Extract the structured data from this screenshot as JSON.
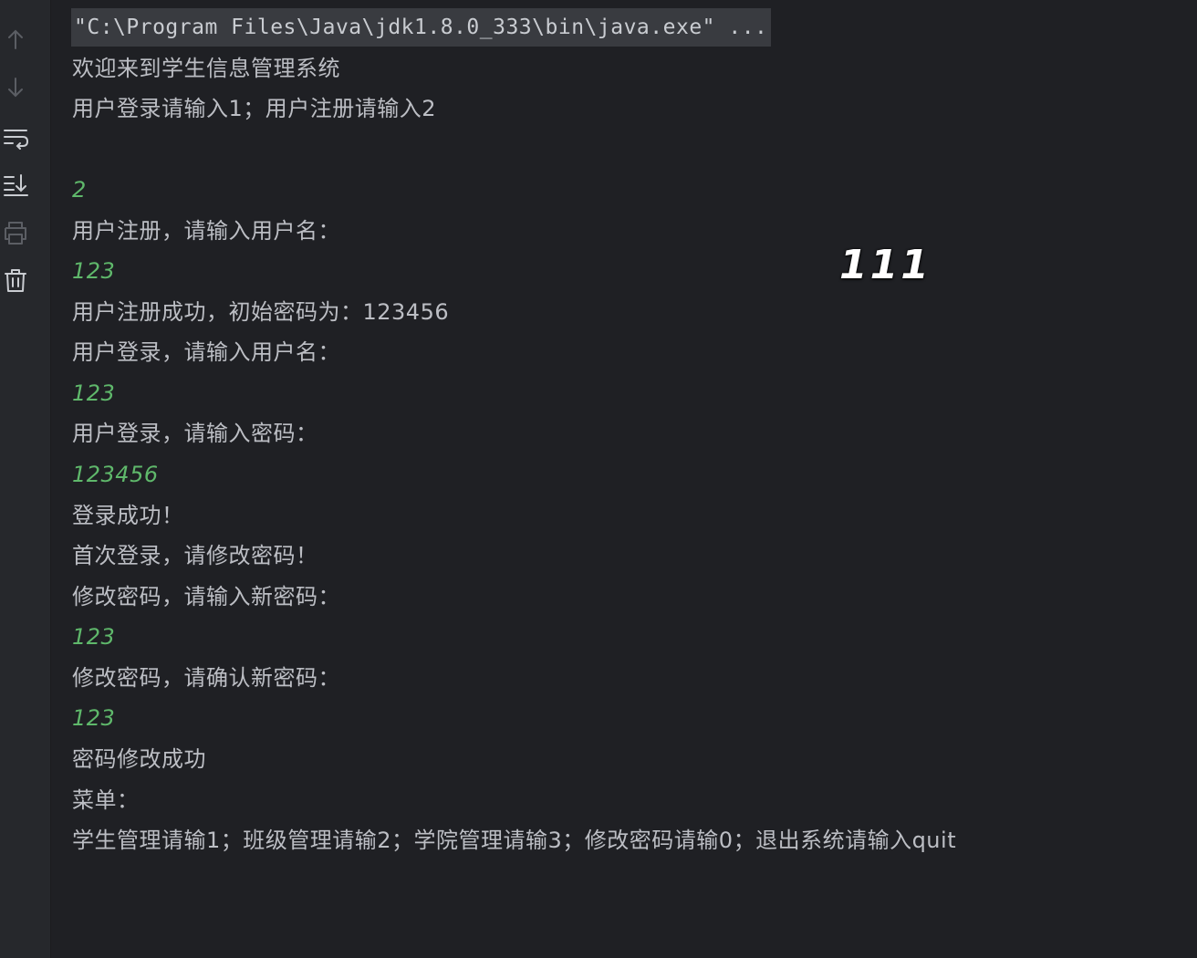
{
  "toolbar": {
    "icons": [
      "arrow-up-icon",
      "arrow-down-icon",
      "soft-wrap-icon",
      "scroll-to-end-icon",
      "print-icon",
      "trash-icon"
    ]
  },
  "console": {
    "command": "\"C:\\Program Files\\Java\\jdk1.8.0_333\\bin\\java.exe\" ...",
    "lines": [
      {
        "type": "output",
        "text": "欢迎来到学生信息管理系统"
      },
      {
        "type": "output",
        "text": "用户登录请输入1；用户注册请输入2"
      },
      {
        "type": "blank",
        "text": ""
      },
      {
        "type": "input",
        "text": "2"
      },
      {
        "type": "output",
        "text": "用户注册，请输入用户名："
      },
      {
        "type": "input",
        "text": "123"
      },
      {
        "type": "output",
        "text": "用户注册成功，初始密码为：123456"
      },
      {
        "type": "output",
        "text": "用户登录，请输入用户名："
      },
      {
        "type": "input",
        "text": "123"
      },
      {
        "type": "output",
        "text": "用户登录，请输入密码："
      },
      {
        "type": "input",
        "text": "123456"
      },
      {
        "type": "output",
        "text": "登录成功！"
      },
      {
        "type": "output",
        "text": "首次登录，请修改密码！"
      },
      {
        "type": "output",
        "text": "修改密码，请输入新密码："
      },
      {
        "type": "input",
        "text": "123"
      },
      {
        "type": "output",
        "text": "修改密码，请确认新密码："
      },
      {
        "type": "input",
        "text": "123"
      },
      {
        "type": "output",
        "text": "密码修改成功"
      },
      {
        "type": "output",
        "text": "菜单："
      },
      {
        "type": "output",
        "text": "学生管理请输1；班级管理请输2；学院管理请输3；修改密码请输0；退出系统请输入quit"
      }
    ]
  },
  "overlay": {
    "watermark": "111"
  },
  "colors": {
    "background": "#1f2024",
    "gutter": "#26282c",
    "output_text": "#bcbec4",
    "input_text": "#5fb86b",
    "command_highlight": "#393b40"
  }
}
